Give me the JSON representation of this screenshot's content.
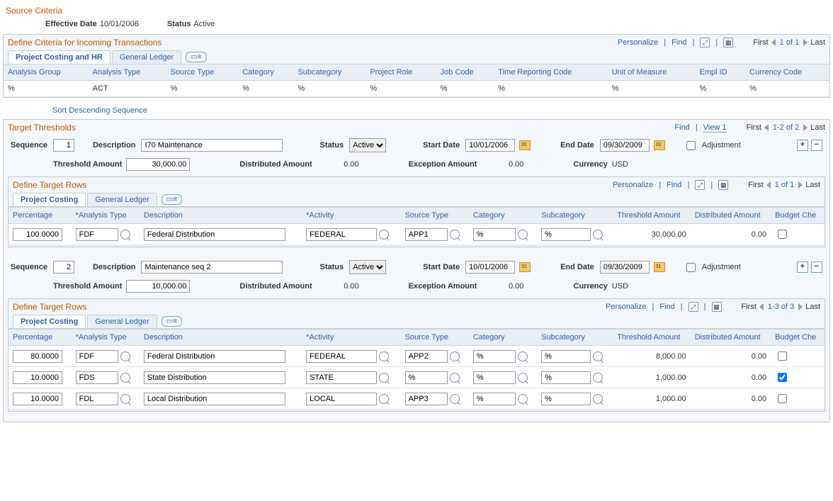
{
  "source_criteria": {
    "title": "Source Criteria",
    "effective_date_label": "Effective Date",
    "effective_date": "10/01/2006",
    "status_label": "Status",
    "status": "Active"
  },
  "incoming": {
    "title": "Define Criteria for Incoming Transactions",
    "tabs": {
      "pc_hr": "Project Costing and HR",
      "gl": "General Ledger"
    },
    "grid": {
      "cols": [
        "Analysis Group",
        "Analysis Type",
        "Source Type",
        "Category",
        "Subcategory",
        "Project Role",
        "Job Code",
        "Time Reporting Code",
        "Unit of Measure",
        "Empl ID",
        "Currency Code"
      ],
      "row": [
        "%",
        "ACT",
        "%",
        "%",
        "%",
        "%",
        "%",
        "%",
        "%",
        "%",
        "%"
      ]
    },
    "nav": {
      "personalize": "Personalize",
      "find": "Find",
      "first": "First",
      "counter": "1 of 1",
      "last": "Last"
    }
  },
  "sort_link": "Sort Descending Sequence",
  "target_thresholds": {
    "title": "Target Thresholds",
    "nav": {
      "find": "Find",
      "view": "View 1",
      "first": "First",
      "counter": "1-2 of 2",
      "last": "Last"
    }
  },
  "labels": {
    "sequence": "Sequence",
    "description": "Description",
    "status": "Status",
    "start_date": "Start Date",
    "end_date": "End Date",
    "adjustment": "Adjustment",
    "threshold_amount": "Threshold Amount",
    "distributed_amount": "Distributed Amount",
    "exception_amount": "Exception Amount",
    "currency": "Currency"
  },
  "thresholds": [
    {
      "sequence": "1",
      "description": "I70 Maintenance",
      "status": "Active",
      "start_date": "10/01/2006",
      "end_date": "09/30/2009",
      "adjustment": false,
      "threshold_amount": "30,000.00",
      "distributed_amount": "0.00",
      "exception_amount": "0.00",
      "currency": "USD",
      "rows_title": "Define Target Rows",
      "nav": {
        "personalize": "Personalize",
        "find": "Find",
        "first": "First",
        "counter": "1 of 1",
        "last": "Last"
      },
      "tabs": {
        "pc": "Project Costing",
        "gl": "General Ledger"
      },
      "cols": [
        "Percentage",
        "*Analysis Type",
        "Description",
        "*Activity",
        "Source Type",
        "Category",
        "Subcategory",
        "Threshold Amount",
        "Distributed Amount",
        "Budget Che"
      ],
      "rows": [
        {
          "pct": "100.0000",
          "atype": "FDF",
          "desc": "Federal Distribution",
          "activity": "FEDERAL",
          "stype": "APP1",
          "cat": "%",
          "subcat": "%",
          "thr": "30,000.00",
          "dist": "0.00",
          "bc": false
        }
      ]
    },
    {
      "sequence": "2",
      "description": "Maintenance seq 2",
      "status": "Active",
      "start_date": "10/01/2006",
      "end_date": "09/30/2009",
      "adjustment": false,
      "threshold_amount": "10,000.00",
      "distributed_amount": "0.00",
      "exception_amount": "0.00",
      "currency": "USD",
      "rows_title": "Define Target Rows",
      "nav": {
        "personalize": "Personalize",
        "find": "Find",
        "first": "First",
        "counter": "1-3 of 3",
        "last": "Last"
      },
      "tabs": {
        "pc": "Project Costing",
        "gl": "General Ledger"
      },
      "cols": [
        "Percentage",
        "*Analysis Type",
        "Description",
        "*Activity",
        "Source Type",
        "Category",
        "Subcategory",
        "Threshold Amount",
        "Distributed Amount",
        "Budget Che"
      ],
      "rows": [
        {
          "pct": "80.0000",
          "atype": "FDF",
          "desc": "Federal Distribution",
          "activity": "FEDERAL",
          "stype": "APP2",
          "cat": "%",
          "subcat": "%",
          "thr": "8,000.00",
          "dist": "0.00",
          "bc": false
        },
        {
          "pct": "10.0000",
          "atype": "FDS",
          "desc": "State Distribution",
          "activity": "STATE",
          "stype": "%",
          "cat": "%",
          "subcat": "%",
          "thr": "1,000.00",
          "dist": "0.00",
          "bc": true
        },
        {
          "pct": "10.0000",
          "atype": "FDL",
          "desc": "Local Distribution",
          "activity": "LOCAL",
          "stype": "APP3",
          "cat": "%",
          "subcat": "%",
          "thr": "1,000.00",
          "dist": "0.00",
          "bc": false
        }
      ]
    }
  ]
}
